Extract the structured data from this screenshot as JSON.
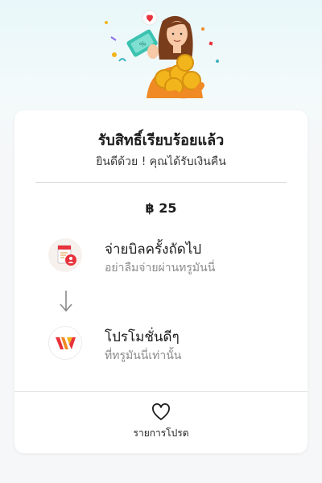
{
  "hero": {
    "illustration": "woman-holding-coupon-and-coins-illustration"
  },
  "card": {
    "title": "รับสิทธิ์เรียบร้อยแล้ว",
    "subtitle": "ยินดีด้วย ! คุณได้รับเงินคืน",
    "amount": "฿ 25"
  },
  "steps": [
    {
      "icon": "bill-document-icon",
      "title": "จ่ายบิลครั้งถัดไป",
      "subtitle": "อย่าลืมจ่ายผ่านทรูมันนี่"
    },
    {
      "icon": "truemoney-w-logo-icon",
      "title": "โปรโมชั่นดีๆ",
      "subtitle": "ที่ทรูมันนี่เท่านั้น"
    }
  ],
  "favorites": {
    "label": "รายการโปรด",
    "icon": "heart-outline-icon"
  },
  "colors": {
    "accent_red": "#e8323c",
    "accent_orange": "#f08a24",
    "coin_gold": "#f2b51b",
    "card_bg": "#ffffff"
  }
}
